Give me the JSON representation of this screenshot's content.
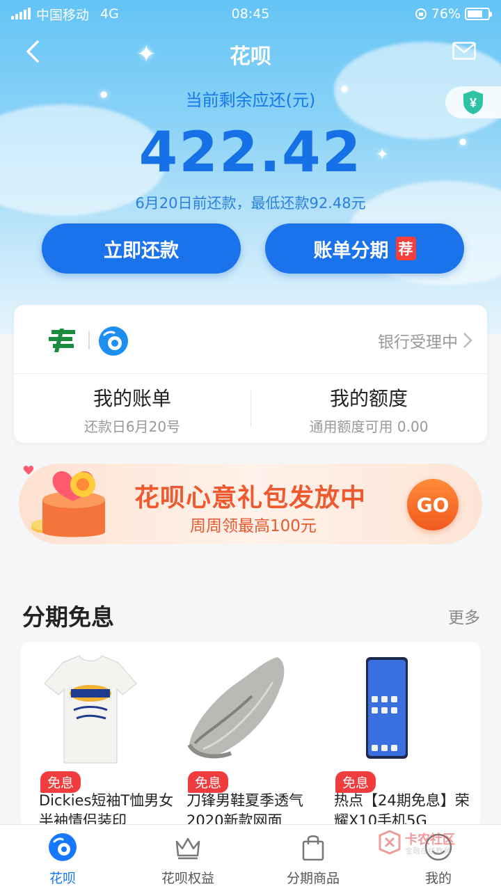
{
  "status_bar": {
    "carrier": "中国移动",
    "network": "4G",
    "time": "08:45",
    "battery": "76%",
    "battery_level": 0.76
  },
  "header": {
    "title": "花呗"
  },
  "summary": {
    "amount_label": "当前剩余应还(元)",
    "amount": "422.42",
    "due_note": "6月20日前还款，最低还款92.48元",
    "repay_button": "立即还款",
    "installment_button": "账单分期",
    "installment_badge": "荐"
  },
  "bank_card": {
    "status": "银行受理中",
    "bill": {
      "title": "我的账单",
      "subtitle": "还款日6月20号"
    },
    "quota": {
      "title": "我的额度",
      "subtitle": "通用额度可用 0.00"
    }
  },
  "banner": {
    "title": "花呗心意礼包发放中",
    "subtitle": "周周领最高100元",
    "go_label": "GO"
  },
  "installment_section": {
    "title": "分期免息",
    "more": "更多",
    "products": [
      {
        "tag": "免息",
        "name": "Dickies短袖T恤男女半袖情侣装印"
      },
      {
        "tag": "免息",
        "name": "刀锋男鞋夏季透气2020新款网面"
      },
      {
        "tag": "免息",
        "name": "热点【24期免息】荣耀X10手机5G"
      }
    ]
  },
  "tab_bar": {
    "items": [
      {
        "label": "花呗",
        "icon": "huabei-icon",
        "active": true
      },
      {
        "label": "花呗权益",
        "icon": "crown-icon",
        "active": false
      },
      {
        "label": "分期商品",
        "icon": "shopping-bag-icon",
        "active": false
      },
      {
        "label": "我的",
        "icon": "profile-icon",
        "active": false
      }
    ]
  },
  "watermark": {
    "title": "卡农社区",
    "subtitle": "金融在线教育"
  },
  "colors": {
    "primary_blue": "#1a73eb",
    "badge_red": "#f43f3f",
    "banner_orange": "#f0582e"
  }
}
